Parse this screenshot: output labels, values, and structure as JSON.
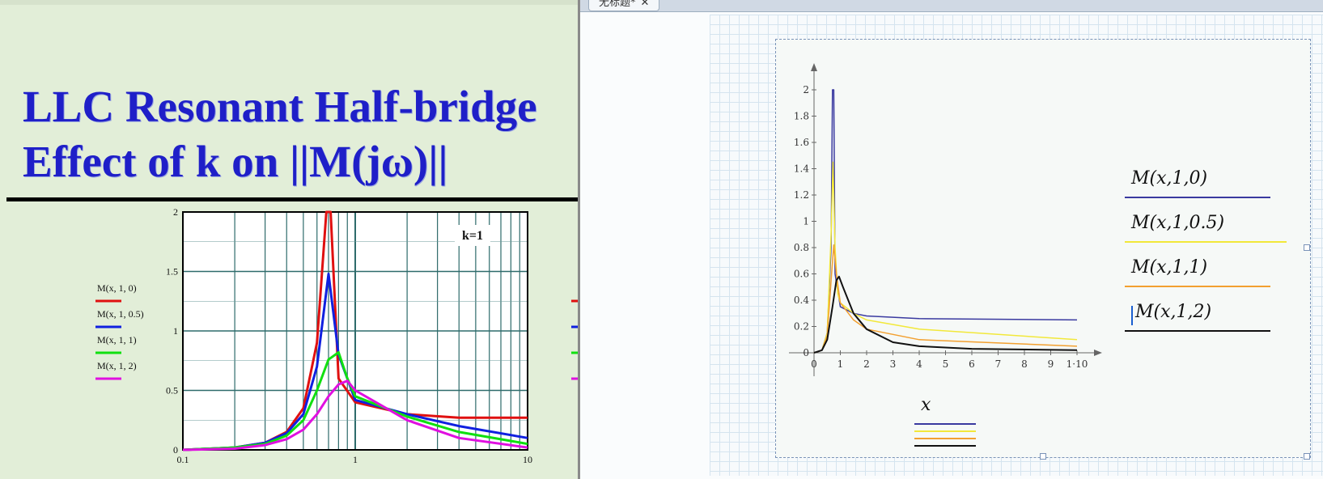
{
  "left_slide": {
    "title_line1": "LLC Resonant Half-bridge",
    "title_line2": "Effect of k on ||M(jω)||",
    "legend": [
      {
        "label": "M(x, 1, 0)",
        "color": "#e01010"
      },
      {
        "label": "M(x, 1, 0.5)",
        "color": "#1020e0"
      },
      {
        "label": "M(x, 1, 1)",
        "color": "#10e010"
      },
      {
        "label": "M(x, 1, 2)",
        "color": "#e010e0"
      }
    ],
    "annotation": "k=1"
  },
  "tab": {
    "title": "无标题*",
    "close_symbol": "✕"
  },
  "right_plot": {
    "x_label": "x",
    "traces": [
      {
        "label": "M(x,1,0)",
        "color": "#3a3aa0"
      },
      {
        "label": "M(x,1,0.5)",
        "color": "#f2e83a"
      },
      {
        "label": "M(x,1,1)",
        "color": "#f2a030"
      },
      {
        "label": "M(x,1,2)",
        "color": "#111111"
      }
    ]
  },
  "chart_data": [
    {
      "type": "line",
      "x_scale": "log",
      "xlim": [
        0.1,
        10
      ],
      "ylim": [
        0,
        2
      ],
      "x_ticks": [
        "0.1",
        "1",
        "10"
      ],
      "y_ticks": [
        "0",
        "0.5",
        "1",
        "1.5",
        "2"
      ],
      "grid": true,
      "legend_position": "left",
      "annotation": "k=1",
      "series": [
        {
          "name": "M(x, 1, 0)",
          "color": "#e01010",
          "x": [
            0.1,
            0.2,
            0.3,
            0.4,
            0.5,
            0.6,
            0.68,
            0.72,
            0.8,
            1,
            2,
            4,
            10
          ],
          "y": [
            0.0,
            0.02,
            0.06,
            0.15,
            0.35,
            0.9,
            2.0,
            2.0,
            0.6,
            0.4,
            0.3,
            0.27,
            0.27
          ]
        },
        {
          "name": "M(x, 1, 0.5)",
          "color": "#1020e0",
          "x": [
            0.1,
            0.2,
            0.3,
            0.4,
            0.5,
            0.6,
            0.7,
            0.8,
            1,
            2,
            4,
            10
          ],
          "y": [
            0.0,
            0.02,
            0.06,
            0.14,
            0.3,
            0.7,
            1.48,
            0.8,
            0.42,
            0.3,
            0.2,
            0.1
          ]
        },
        {
          "name": "M(x, 1, 1)",
          "color": "#10e010",
          "x": [
            0.1,
            0.2,
            0.3,
            0.4,
            0.5,
            0.6,
            0.7,
            0.8,
            0.9,
            1,
            2,
            4,
            10
          ],
          "y": [
            0.0,
            0.02,
            0.05,
            0.12,
            0.25,
            0.5,
            0.76,
            0.82,
            0.6,
            0.45,
            0.28,
            0.15,
            0.05
          ]
        },
        {
          "name": "M(x, 1, 2)",
          "color": "#e010e0",
          "x": [
            0.1,
            0.2,
            0.3,
            0.4,
            0.5,
            0.6,
            0.7,
            0.8,
            0.9,
            1,
            2,
            4,
            10
          ],
          "y": [
            0.0,
            0.01,
            0.04,
            0.09,
            0.17,
            0.3,
            0.45,
            0.55,
            0.58,
            0.5,
            0.25,
            0.1,
            0.02
          ]
        }
      ]
    },
    {
      "type": "line",
      "xlim": [
        0,
        10
      ],
      "ylim": [
        0,
        2
      ],
      "x_ticks": [
        "0",
        "1",
        "2",
        "3",
        "4",
        "5",
        "6",
        "7",
        "8",
        "9",
        "1·10"
      ],
      "y_ticks": [
        "0",
        "0.2",
        "0.4",
        "0.6",
        "0.8",
        "1",
        "1.2",
        "1.4",
        "1.6",
        "1.8",
        "2"
      ],
      "xlabel": "x",
      "grid": false,
      "series": [
        {
          "name": "M(x,1,0)",
          "color": "#3a3aa0",
          "x": [
            0,
            0.3,
            0.5,
            0.65,
            0.7,
            0.72,
            0.75,
            0.8,
            1,
            1.5,
            2,
            4,
            10
          ],
          "y": [
            0,
            0.02,
            0.15,
            0.8,
            2.0,
            2.0,
            2.0,
            0.6,
            0.35,
            0.3,
            0.28,
            0.26,
            0.25
          ]
        },
        {
          "name": "M(x,1,0.5)",
          "color": "#f2e83a",
          "x": [
            0,
            0.3,
            0.5,
            0.65,
            0.72,
            0.8,
            0.9,
            1,
            1.5,
            2,
            4,
            10
          ],
          "y": [
            0,
            0.02,
            0.15,
            0.9,
            1.45,
            0.8,
            0.45,
            0.38,
            0.3,
            0.25,
            0.18,
            0.1
          ]
        },
        {
          "name": "M(x,1,1)",
          "color": "#f2a030",
          "x": [
            0,
            0.3,
            0.5,
            0.65,
            0.75,
            0.85,
            1,
            1.5,
            2,
            4,
            10
          ],
          "y": [
            0,
            0.02,
            0.13,
            0.55,
            0.82,
            0.6,
            0.38,
            0.25,
            0.18,
            0.1,
            0.05
          ]
        },
        {
          "name": "M(x,1,2)",
          "color": "#111111",
          "x": [
            0,
            0.3,
            0.5,
            0.7,
            0.85,
            0.95,
            1.1,
            1.5,
            2,
            3,
            4,
            6,
            10
          ],
          "y": [
            0,
            0.02,
            0.1,
            0.35,
            0.55,
            0.58,
            0.5,
            0.3,
            0.18,
            0.08,
            0.05,
            0.03,
            0.02
          ]
        }
      ]
    }
  ]
}
